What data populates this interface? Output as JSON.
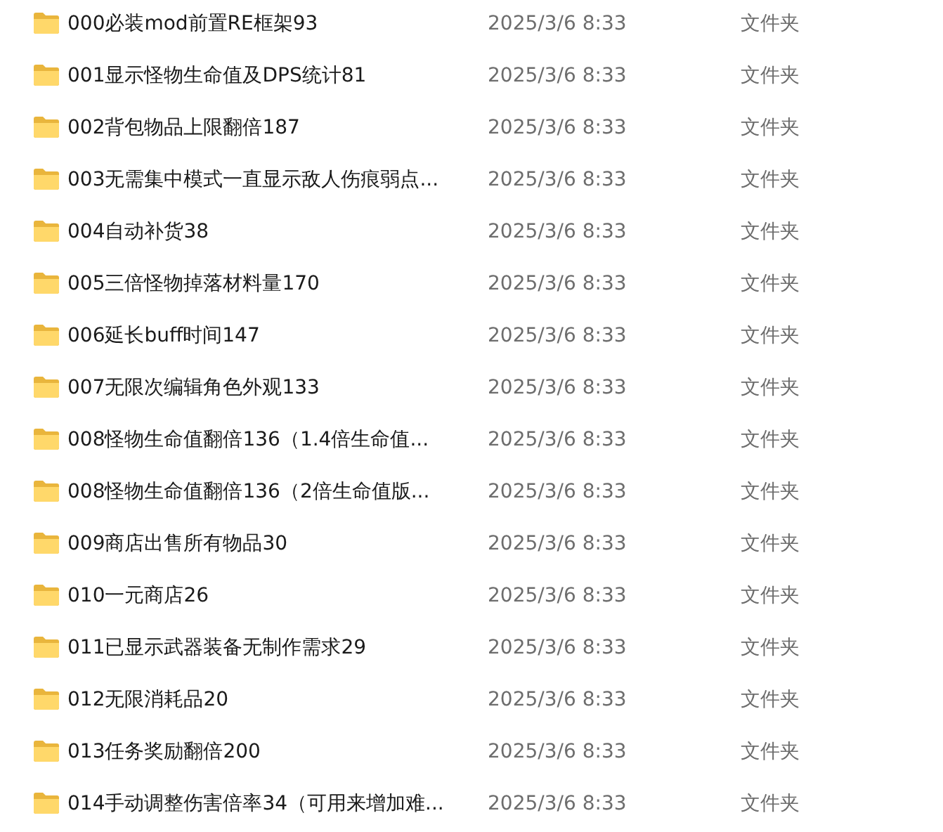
{
  "files": [
    {
      "name": "000必装mod前置RE框架93",
      "modified": "2025/3/6 8:33",
      "type": "文件夹"
    },
    {
      "name": "001显示怪物生命值及DPS统计81",
      "modified": "2025/3/6 8:33",
      "type": "文件夹"
    },
    {
      "name": "002背包物品上限翻倍187",
      "modified": "2025/3/6 8:33",
      "type": "文件夹"
    },
    {
      "name": "003无需集中模式一直显示敌人伤痕弱点...",
      "modified": "2025/3/6 8:33",
      "type": "文件夹"
    },
    {
      "name": "004自动补货38",
      "modified": "2025/3/6 8:33",
      "type": "文件夹"
    },
    {
      "name": "005三倍怪物掉落材料量170",
      "modified": "2025/3/6 8:33",
      "type": "文件夹"
    },
    {
      "name": "006延长buff时间147",
      "modified": "2025/3/6 8:33",
      "type": "文件夹"
    },
    {
      "name": "007无限次编辑角色外观133",
      "modified": "2025/3/6 8:33",
      "type": "文件夹"
    },
    {
      "name": "008怪物生命值翻倍136（1.4倍生命值...",
      "modified": "2025/3/6 8:33",
      "type": "文件夹"
    },
    {
      "name": "008怪物生命值翻倍136（2倍生命值版...",
      "modified": "2025/3/6 8:33",
      "type": "文件夹"
    },
    {
      "name": "009商店出售所有物品30",
      "modified": "2025/3/6 8:33",
      "type": "文件夹"
    },
    {
      "name": "010一元商店26",
      "modified": "2025/3/6 8:33",
      "type": "文件夹"
    },
    {
      "name": "011已显示武器装备无制作需求29",
      "modified": "2025/3/6 8:33",
      "type": "文件夹"
    },
    {
      "name": "012无限消耗品20",
      "modified": "2025/3/6 8:33",
      "type": "文件夹"
    },
    {
      "name": "013任务奖励翻倍200",
      "modified": "2025/3/6 8:33",
      "type": "文件夹"
    },
    {
      "name": "014手动调整伤害倍率34（可用来增加难...",
      "modified": "2025/3/6 8:33",
      "type": "文件夹"
    }
  ]
}
